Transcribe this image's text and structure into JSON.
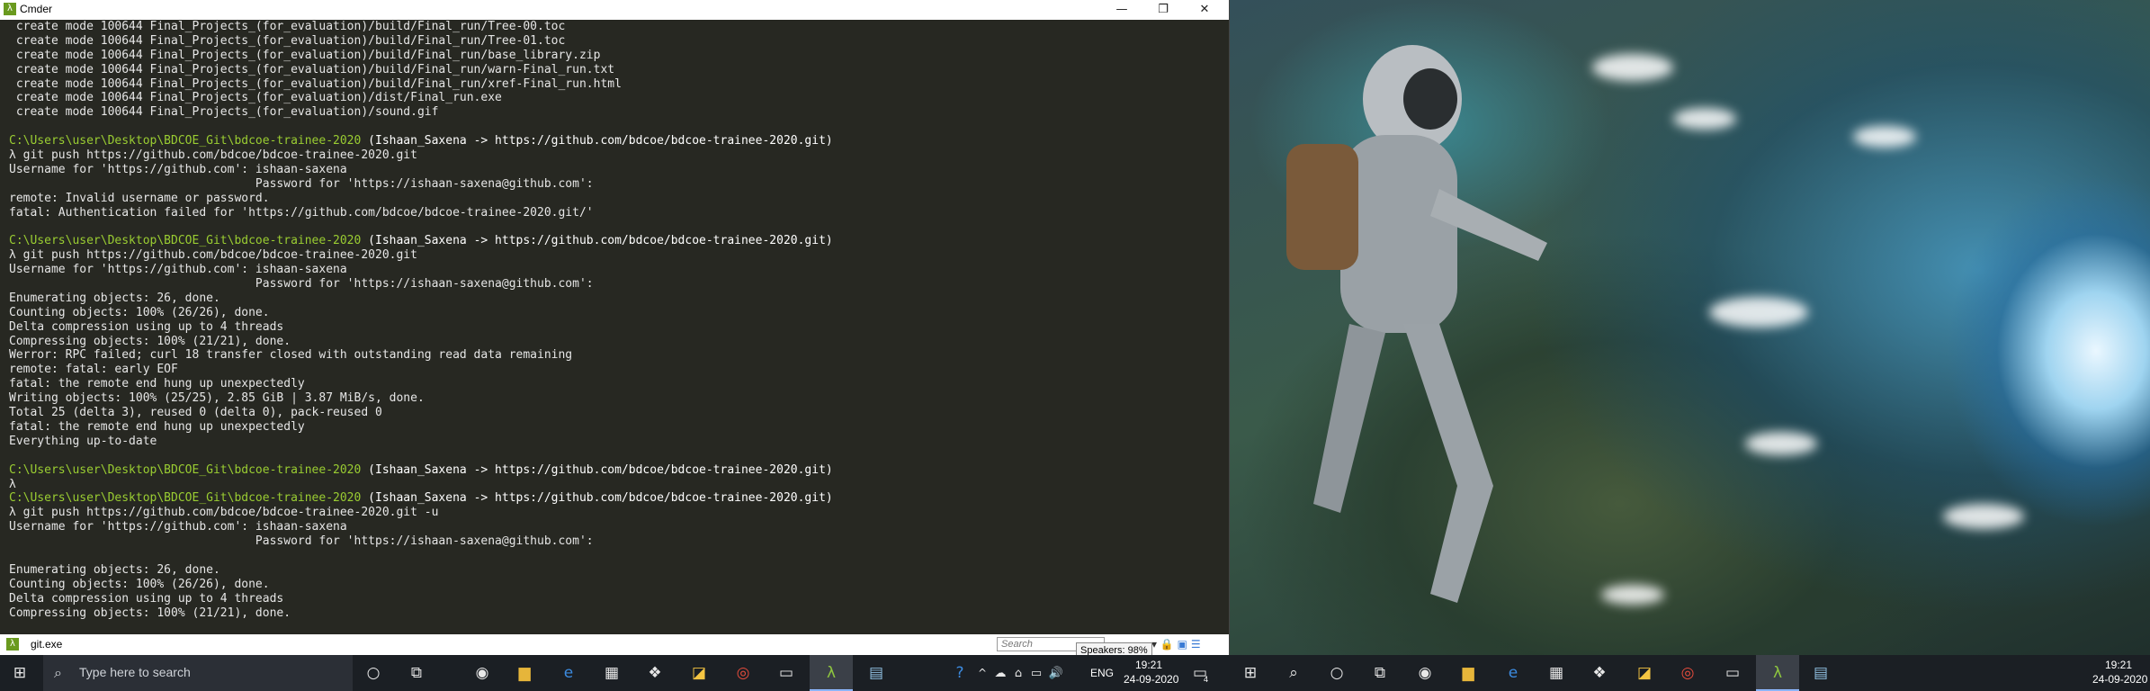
{
  "window": {
    "title": "Cmder",
    "minimize": "—",
    "maximize": "❐",
    "close": "✕"
  },
  "console_lines": [
    {
      "text": " create mode 100644 Final_Projects_(for_evaluation)/build/Final_run/Tree-00.toc"
    },
    {
      "text": " create mode 100644 Final_Projects_(for_evaluation)/build/Final_run/Tree-01.toc"
    },
    {
      "text": " create mode 100644 Final_Projects_(for_evaluation)/build/Final_run/base_library.zip"
    },
    {
      "text": " create mode 100644 Final_Projects_(for_evaluation)/build/Final_run/warn-Final_run.txt"
    },
    {
      "text": " create mode 100644 Final_Projects_(for_evaluation)/build/Final_run/xref-Final_run.html"
    },
    {
      "text": " create mode 100644 Final_Projects_(for_evaluation)/dist/Final_run.exe"
    },
    {
      "text": " create mode 100644 Final_Projects_(for_evaluation)/sound.gif"
    },
    {
      "text": ""
    },
    {
      "path": "C:\\Users\\user\\Desktop\\BDCOE_Git\\bdcoe-trainee-2020",
      "branch": " (Ishaan_Saxena -> https://github.com/bdcoe/bdcoe-trainee-2020.git)"
    },
    {
      "text": "λ git push https://github.com/bdcoe/bdcoe-trainee-2020.git"
    },
    {
      "text": "Username for 'https://github.com': ishaan-saxena"
    },
    {
      "text": "                                   Password for 'https://ishaan-saxena@github.com':"
    },
    {
      "text": "remote: Invalid username or password."
    },
    {
      "text": "fatal: Authentication failed for 'https://github.com/bdcoe/bdcoe-trainee-2020.git/'"
    },
    {
      "text": ""
    },
    {
      "path": "C:\\Users\\user\\Desktop\\BDCOE_Git\\bdcoe-trainee-2020",
      "branch": " (Ishaan_Saxena -> https://github.com/bdcoe/bdcoe-trainee-2020.git)"
    },
    {
      "text": "λ git push https://github.com/bdcoe/bdcoe-trainee-2020.git"
    },
    {
      "text": "Username for 'https://github.com': ishaan-saxena"
    },
    {
      "text": "                                   Password for 'https://ishaan-saxena@github.com':"
    },
    {
      "text": "Enumerating objects: 26, done."
    },
    {
      "text": "Counting objects: 100% (26/26), done."
    },
    {
      "text": "Delta compression using up to 4 threads"
    },
    {
      "text": "Compressing objects: 100% (21/21), done."
    },
    {
      "text": "Werror: RPC failed; curl 18 transfer closed with outstanding read data remaining"
    },
    {
      "text": "remote: fatal: early EOF"
    },
    {
      "text": "fatal: the remote end hung up unexpectedly"
    },
    {
      "text": "Writing objects: 100% (25/25), 2.85 GiB | 3.87 MiB/s, done."
    },
    {
      "text": "Total 25 (delta 3), reused 0 (delta 0), pack-reused 0"
    },
    {
      "text": "fatal: the remote end hung up unexpectedly"
    },
    {
      "text": "Everything up-to-date"
    },
    {
      "text": ""
    },
    {
      "path": "C:\\Users\\user\\Desktop\\BDCOE_Git\\bdcoe-trainee-2020",
      "branch": " (Ishaan_Saxena -> https://github.com/bdcoe/bdcoe-trainee-2020.git)"
    },
    {
      "text": "λ"
    },
    {
      "path": "C:\\Users\\user\\Desktop\\BDCOE_Git\\bdcoe-trainee-2020",
      "branch": " (Ishaan_Saxena -> https://github.com/bdcoe/bdcoe-trainee-2020.git)"
    },
    {
      "text": "λ git push https://github.com/bdcoe/bdcoe-trainee-2020.git -u"
    },
    {
      "text": "Username for 'https://github.com': ishaan-saxena"
    },
    {
      "text": "                                   Password for 'https://ishaan-saxena@github.com':"
    },
    {
      "text": ""
    },
    {
      "text": "Enumerating objects: 26, done."
    },
    {
      "text": "Counting objects: 100% (26/26), done."
    },
    {
      "text": "Delta compression using up to 4 threads"
    },
    {
      "text": "Compressing objects: 100% (21/21), done."
    }
  ],
  "statusbar": {
    "tab_label": "git.exe",
    "search_placeholder": "Search",
    "tooltip": "Speakers: 98%"
  },
  "taskbar": {
    "search_placeholder": "Type here to search",
    "language": "ENG",
    "time": "19:21",
    "date": "24-09-2020",
    "notification_count": "4",
    "secondary_time": "19:21",
    "secondary_date": "24-09-2020"
  },
  "colors": {
    "prompt_path": "#9acd32",
    "console_bg": "#272822",
    "taskbar_bg": "#1b1f24"
  }
}
